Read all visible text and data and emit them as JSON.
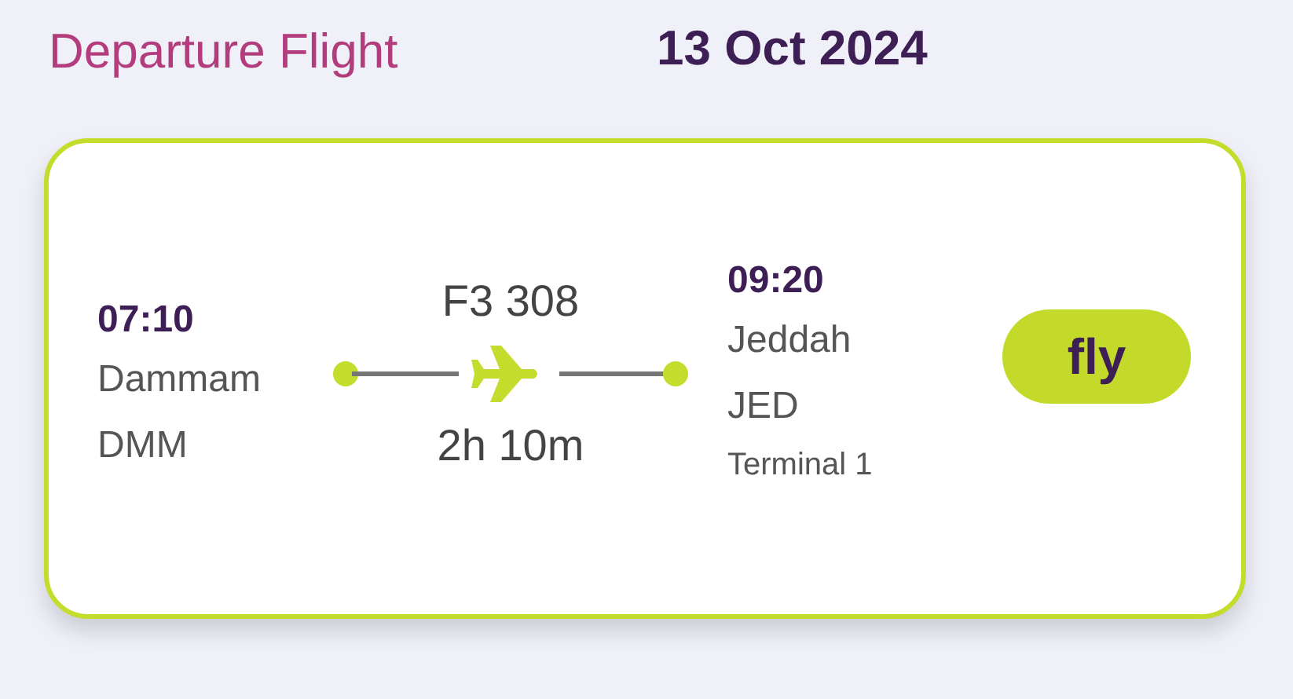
{
  "header": {
    "title": "Departure Flight",
    "date": "13 Oct 2024"
  },
  "flight": {
    "departure": {
      "time": "07:10",
      "city": "Dammam",
      "code": "DMM"
    },
    "number": "F3 308",
    "duration": "2h 10m",
    "arrival": {
      "time": "09:20",
      "city": "Jeddah",
      "code": "JED",
      "terminal": "Terminal 1"
    },
    "airline_button": "fly"
  }
}
